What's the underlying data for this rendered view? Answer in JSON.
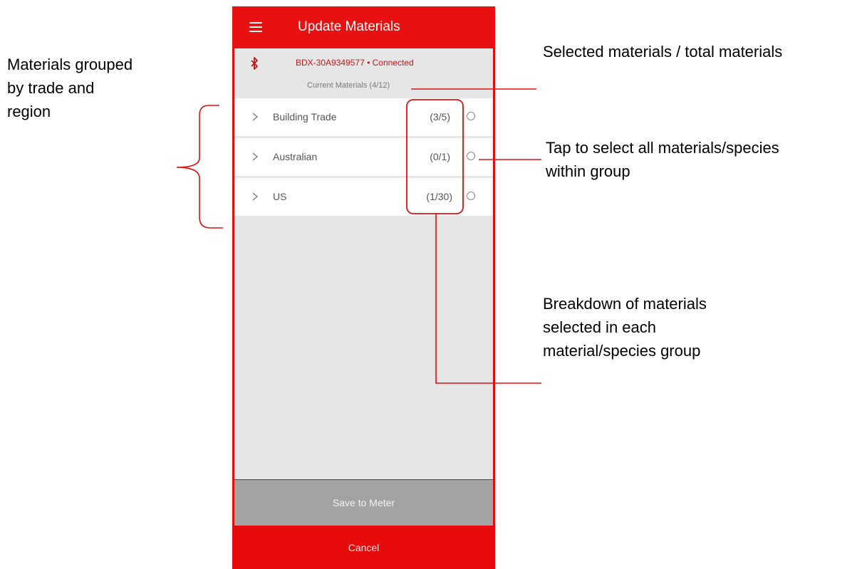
{
  "app": {
    "title": "Update Materials",
    "menu_icon": "hamburger-menu-icon"
  },
  "device": {
    "icon": "bluetooth-icon",
    "status": "BDX-30A9349577 • Connected"
  },
  "materials_summary": "Current Materials (4/12)",
  "groups": [
    {
      "name": "Building Trade",
      "count": "(3/5)",
      "selected": false
    },
    {
      "name": "Australian",
      "count": "(0/1)",
      "selected": false
    },
    {
      "name": "US",
      "count": "(1/30)",
      "selected": false
    }
  ],
  "buttons": {
    "save": "Save to Meter",
    "cancel": "Cancel"
  },
  "annotations": {
    "grouped": [
      "Materials grouped",
      "by trade and",
      "region"
    ],
    "selected_total": "Selected materials / total materials",
    "tap_select": [
      "Tap to select all materials/species",
      "within group"
    ],
    "breakdown": [
      "Breakdown of materials",
      "selected in each",
      "material/species group"
    ]
  },
  "colors": {
    "brand_red": "#e60a0a",
    "annotation_red": "#e01010",
    "save_gray": "#a3a3a3",
    "background_gray": "#e6e6e6"
  }
}
